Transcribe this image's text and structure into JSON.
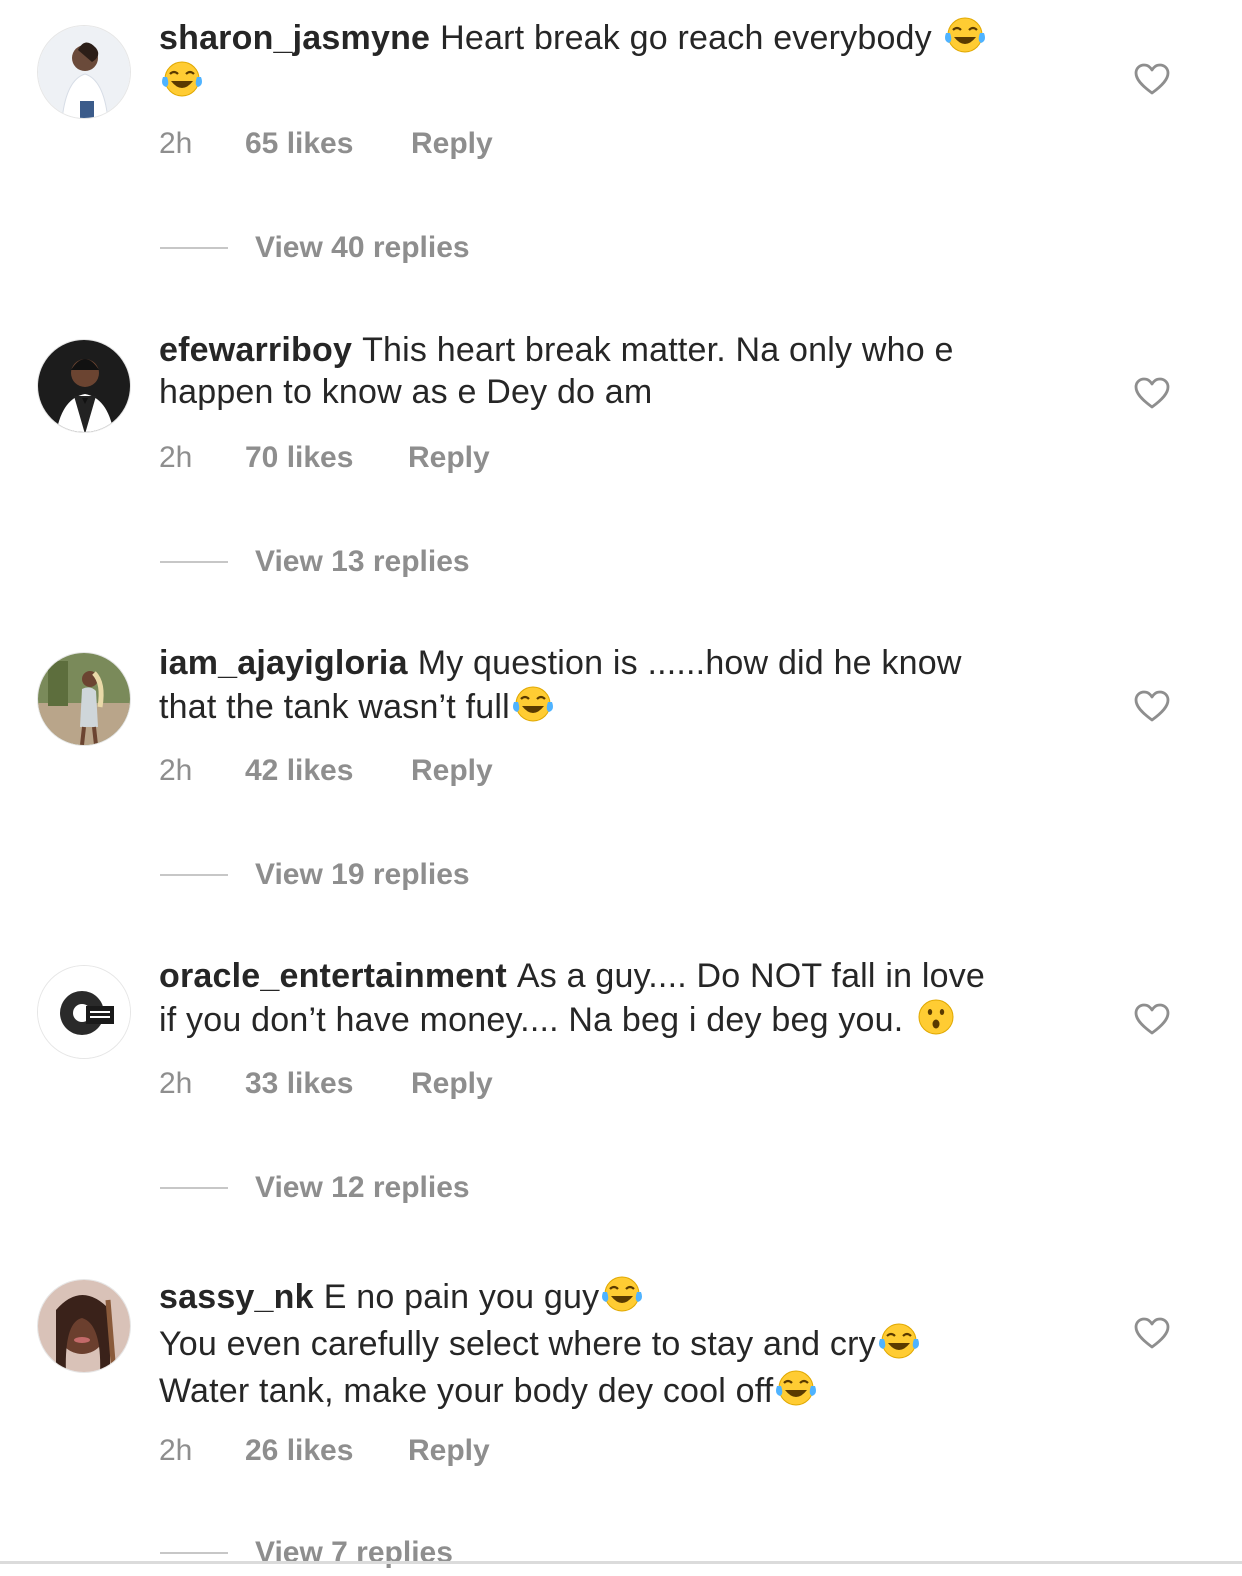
{
  "comments": [
    {
      "username": "sharon_jasmyne",
      "lines": [
        "Heart break go reach everybody"
      ],
      "line2_emoji_only": true,
      "time": "2h",
      "likes": "65 likes",
      "reply": "Reply",
      "view_replies": "View 40 replies"
    },
    {
      "username": "efewarriboy",
      "lines": [
        "This heart break matter. Na only who e",
        "happen to know as e Dey do am"
      ],
      "time": "2h",
      "likes": "70 likes",
      "reply": "Reply",
      "view_replies": "View 13 replies"
    },
    {
      "username": "iam_ajayigloria",
      "lines": [
        "My question is ......how did he know",
        "that the tank wasn’t full"
      ],
      "time": "2h",
      "likes": "42 likes",
      "reply": "Reply",
      "view_replies": "View 19 replies"
    },
    {
      "username": "oracle_entertainment",
      "lines": [
        "As a guy.... Do NOT fall in love",
        "if you don’t have money.... Na beg i dey beg you."
      ],
      "time": "2h",
      "likes": "33 likes",
      "reply": "Reply",
      "view_replies": "View 12 replies"
    },
    {
      "username": "sassy_nk",
      "lines": [
        "E no pain you guy",
        "You even carefully select where to stay and cry",
        "Water tank, make your body dey cool off"
      ],
      "time": "2h",
      "likes": "26 likes",
      "reply": "Reply",
      "view_replies": "View 7 replies"
    }
  ],
  "icons": {
    "like": "heart-outline-icon",
    "emoji_laugh": "face-with-tears-of-joy-icon",
    "emoji_surprised": "hushed-face-icon"
  },
  "colors": {
    "text": "#262626",
    "muted": "#8e8e8e",
    "emoji_yellow": "#ffcc33",
    "tear_blue": "#4fb3ff"
  }
}
